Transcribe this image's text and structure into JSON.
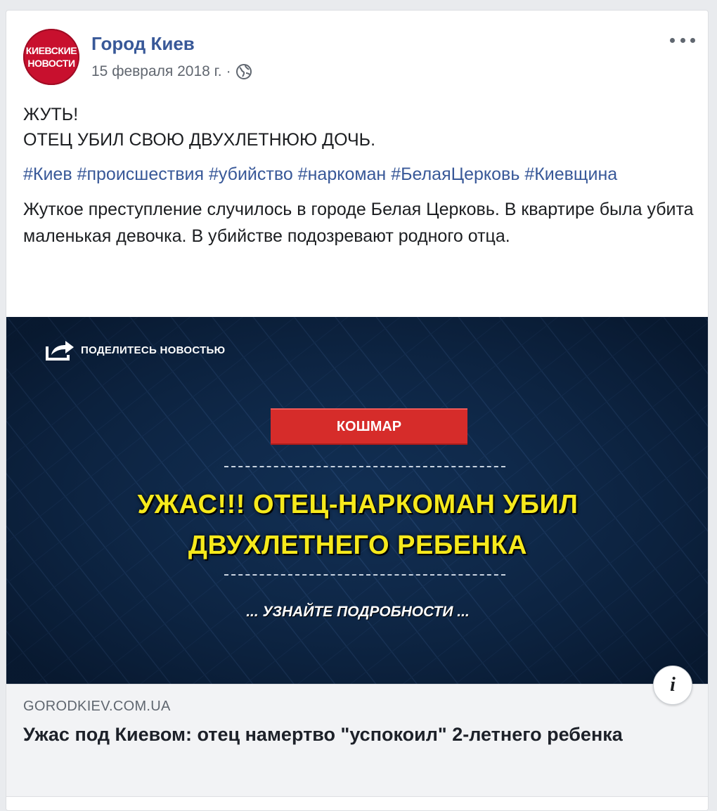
{
  "post": {
    "page_name": "Город Киев",
    "avatar_text": [
      "КИЕВСКИЕ",
      "НОВОСТИ"
    ],
    "date": "15 февраля 2018 г.",
    "separator": "·",
    "privacy_icon": "globe-icon",
    "menu_icon": "more-horizontal-icon",
    "text_lines": [
      "ЖУТЬ!",
      "ОТЕЦ УБИЛ СВОЮ ДВУХЛЕТНЮЮ ДОЧЬ."
    ],
    "hashtags": [
      "#Киев",
      "#происшествия",
      "#убийство",
      "#наркоман",
      "#БелаяЦерковь",
      "#Киевщина"
    ],
    "body": "Жуткое преступление случилось в городе Белая Церковь. В квартире была убита маленькая девочка. В убийстве подозревают родного отца."
  },
  "image": {
    "share_label": "ПОДЕЛИТЕСЬ НОВОСТЬЮ",
    "banner": "КОШМАР",
    "headline_line1": "УЖАС!!! ОТЕЦ-НАРКОМАН УБИЛ",
    "headline_line2": "ДВУХЛЕТНЕГО РЕБЕНКА",
    "more": "... УЗНАЙТЕ ПОДРОБНОСТИ ...",
    "colors": {
      "background": "#0b2242",
      "banner": "#d62c2a",
      "headline": "#f6e91c"
    }
  },
  "link": {
    "domain": "GORODKIEV.COM.UA",
    "title": "Ужас под Киевом: отец намертво \"успокоил\" 2-летнего ребенка",
    "info_icon": "info-icon"
  },
  "colors": {
    "link_blue": "#385898",
    "text": "#1c1e21",
    "muted": "#606770"
  }
}
